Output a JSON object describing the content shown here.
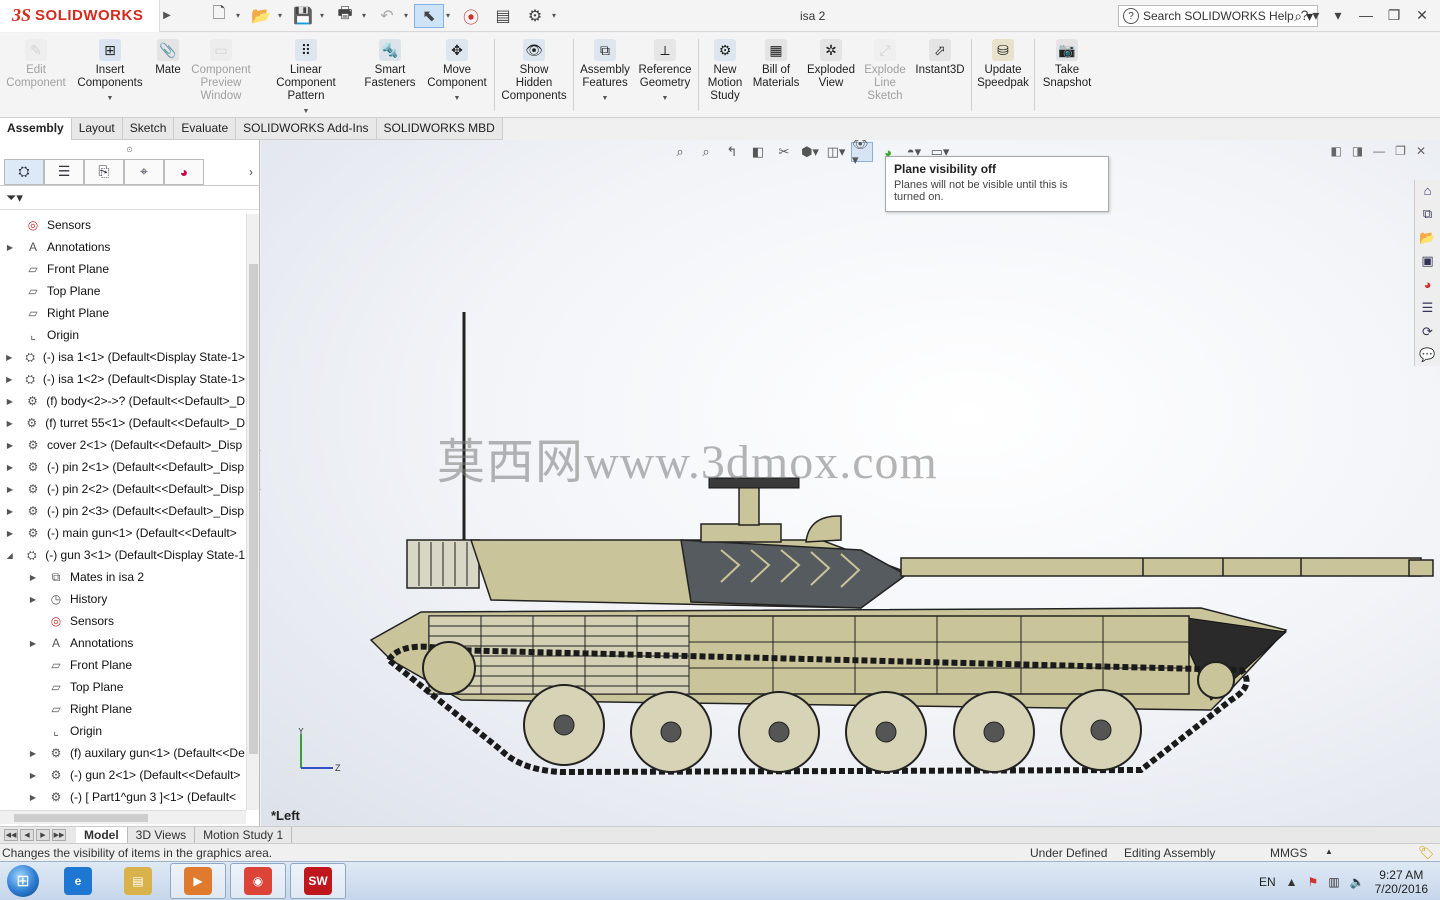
{
  "app": {
    "brand_mark": "3S",
    "brand_name": "SOLIDWORKS",
    "doc_title": "isa 2",
    "search_placeholder": "Search SOLIDWORKS Help"
  },
  "commands": [
    {
      "label": "Edit Component",
      "enabled": false,
      "icon": "edit-component-icon"
    },
    {
      "label": "Insert Components",
      "enabled": true,
      "icon": "insert-components-icon"
    },
    {
      "label": "Mate",
      "enabled": true,
      "icon": "mate-icon"
    },
    {
      "label": "Component Preview Window",
      "enabled": false,
      "icon": "preview-window-icon"
    },
    {
      "label": "Linear Component Pattern",
      "enabled": true,
      "icon": "linear-pattern-icon"
    },
    {
      "label": "Smart Fasteners",
      "enabled": true,
      "icon": "smart-fasteners-icon"
    },
    {
      "label": "Move Component",
      "enabled": true,
      "icon": "move-component-icon"
    },
    {
      "label": "Show Hidden Components",
      "enabled": true,
      "icon": "show-hidden-icon"
    },
    {
      "label": "Assembly Features",
      "enabled": true,
      "icon": "assembly-features-icon"
    },
    {
      "label": "Reference Geometry",
      "enabled": true,
      "icon": "reference-geometry-icon"
    },
    {
      "label": "New Motion Study",
      "enabled": true,
      "icon": "motion-study-icon"
    },
    {
      "label": "Bill of Materials",
      "enabled": true,
      "icon": "bom-icon"
    },
    {
      "label": "Exploded View",
      "enabled": true,
      "icon": "exploded-view-icon"
    },
    {
      "label": "Explode Line Sketch",
      "enabled": false,
      "icon": "explode-line-icon"
    },
    {
      "label": "Instant3D",
      "enabled": true,
      "icon": "instant3d-icon"
    },
    {
      "label": "Update Speedpak",
      "enabled": true,
      "icon": "speedpak-icon"
    },
    {
      "label": "Take Snapshot",
      "enabled": true,
      "icon": "snapshot-icon"
    }
  ],
  "tabs": [
    "Assembly",
    "Layout",
    "Sketch",
    "Evaluate",
    "SOLIDWORKS Add-Ins",
    "SOLIDWORKS MBD"
  ],
  "active_tab": "Assembly",
  "tree": [
    {
      "label": "Sensors",
      "indent": 0,
      "expander": "",
      "icon": "sensor-icon"
    },
    {
      "label": "Annotations",
      "indent": 0,
      "expander": "▶",
      "icon": "annotations-icon"
    },
    {
      "label": "Front Plane",
      "indent": 0,
      "expander": "",
      "icon": "plane-icon"
    },
    {
      "label": "Top Plane",
      "indent": 0,
      "expander": "",
      "icon": "plane-icon"
    },
    {
      "label": "Right Plane",
      "indent": 0,
      "expander": "",
      "icon": "plane-icon"
    },
    {
      "label": "Origin",
      "indent": 0,
      "expander": "",
      "icon": "origin-icon"
    },
    {
      "label": "(-) isa 1<1> (Default<Display State-1>",
      "indent": 0,
      "expander": "▶",
      "icon": "assembly-icon"
    },
    {
      "label": "(-) isa 1<2> (Default<Display State-1>",
      "indent": 0,
      "expander": "▶",
      "icon": "assembly-icon"
    },
    {
      "label": "(f) body<2>->? (Default<<Default>_D",
      "indent": 0,
      "expander": "▶",
      "icon": "part-icon"
    },
    {
      "label": "(f) turret 55<1> (Default<<Default>_D",
      "indent": 0,
      "expander": "▶",
      "icon": "part-icon"
    },
    {
      "label": "cover 2<1> (Default<<Default>_Disp",
      "indent": 0,
      "expander": "▶",
      "icon": "part-icon"
    },
    {
      "label": "(-) pin 2<1> (Default<<Default>_Disp",
      "indent": 0,
      "expander": "▶",
      "icon": "part-icon"
    },
    {
      "label": "(-) pin 2<2> (Default<<Default>_Disp",
      "indent": 0,
      "expander": "▶",
      "icon": "part-icon"
    },
    {
      "label": "(-) pin 2<3> (Default<<Default>_Disp",
      "indent": 0,
      "expander": "▶",
      "icon": "part-icon"
    },
    {
      "label": "(-) main gun<1> (Default<<Default>",
      "indent": 0,
      "expander": "▶",
      "icon": "part-icon"
    },
    {
      "label": "(-) gun 3<1> (Default<Display State-1",
      "indent": 0,
      "expander": "◢",
      "icon": "assembly-icon"
    },
    {
      "label": "Mates in isa 2",
      "indent": 1,
      "expander": "▶",
      "icon": "mates-icon"
    },
    {
      "label": "History",
      "indent": 1,
      "expander": "▶",
      "icon": "history-icon"
    },
    {
      "label": "Sensors",
      "indent": 1,
      "expander": "",
      "icon": "sensor-icon"
    },
    {
      "label": "Annotations",
      "indent": 1,
      "expander": "▶",
      "icon": "annotations-icon"
    },
    {
      "label": "Front Plane",
      "indent": 1,
      "expander": "",
      "icon": "plane-icon"
    },
    {
      "label": "Top Plane",
      "indent": 1,
      "expander": "",
      "icon": "plane-icon"
    },
    {
      "label": "Right Plane",
      "indent": 1,
      "expander": "",
      "icon": "plane-icon"
    },
    {
      "label": "Origin",
      "indent": 1,
      "expander": "",
      "icon": "origin-icon"
    },
    {
      "label": "(f) auxilary gun<1> (Default<<De",
      "indent": 1,
      "expander": "▶",
      "icon": "part-icon"
    },
    {
      "label": "(-) gun 2<1> (Default<<Default>",
      "indent": 1,
      "expander": "▶",
      "icon": "part-icon"
    },
    {
      "label": "(-) [ Part1^gun 3 ]<1> (Default<",
      "indent": 1,
      "expander": "▶",
      "icon": "part-icon"
    }
  ],
  "tooltip": {
    "title": "Plane visibility off",
    "body": "Planes will not be visible until this is turned on."
  },
  "viewport": {
    "watermark": "莫西网www.3dmox.com",
    "view_label": "*Left",
    "triad": {
      "y": "Y",
      "z": "Z"
    },
    "model_colors": {
      "hull": "#c9c49a",
      "dark": "#2a2a2a",
      "armor": "#555b5e"
    }
  },
  "bottom_tabs": [
    "Model",
    "3D Views",
    "Motion Study 1"
  ],
  "active_bottom_tab": "Model",
  "status": {
    "message": "Changes the visibility of items in the graphics area.",
    "definition": "Under Defined",
    "mode": "Editing Assembly",
    "units": "MMGS"
  },
  "taskbar": {
    "apps": [
      {
        "name": "internet-explorer",
        "color": "#1e77d2",
        "glyph": "e"
      },
      {
        "name": "file-explorer",
        "color": "#d9b24c",
        "glyph": "▤"
      },
      {
        "name": "media-player",
        "color": "#e07a2c",
        "glyph": "▶"
      },
      {
        "name": "chrome",
        "color": "#db4437",
        "glyph": "◉"
      },
      {
        "name": "solidworks-2016",
        "color": "#c0171d",
        "glyph": "SW"
      }
    ],
    "language": "EN",
    "time": "9:27 AM",
    "date": "7/20/2016"
  }
}
